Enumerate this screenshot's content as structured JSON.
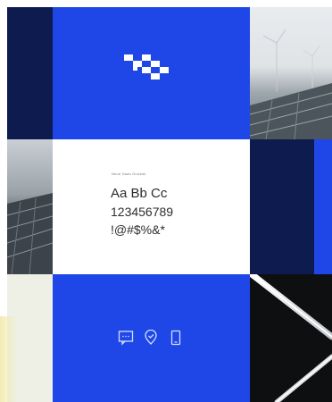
{
  "typography_specimen": {
    "label": "Neue Haas Grotesk",
    "line1": "Aa Bb Cc",
    "line2": "123456789",
    "line3": "!@#$%&*"
  },
  "icons": [
    "chat-icon",
    "location-pin-icon",
    "mobile-phone-icon"
  ],
  "colors": {
    "brand_blue": "#1f47e8",
    "navy": "#0d1b4f",
    "white": "#ffffff",
    "off_white": "#eef0e6",
    "black": "#0e0f11"
  }
}
